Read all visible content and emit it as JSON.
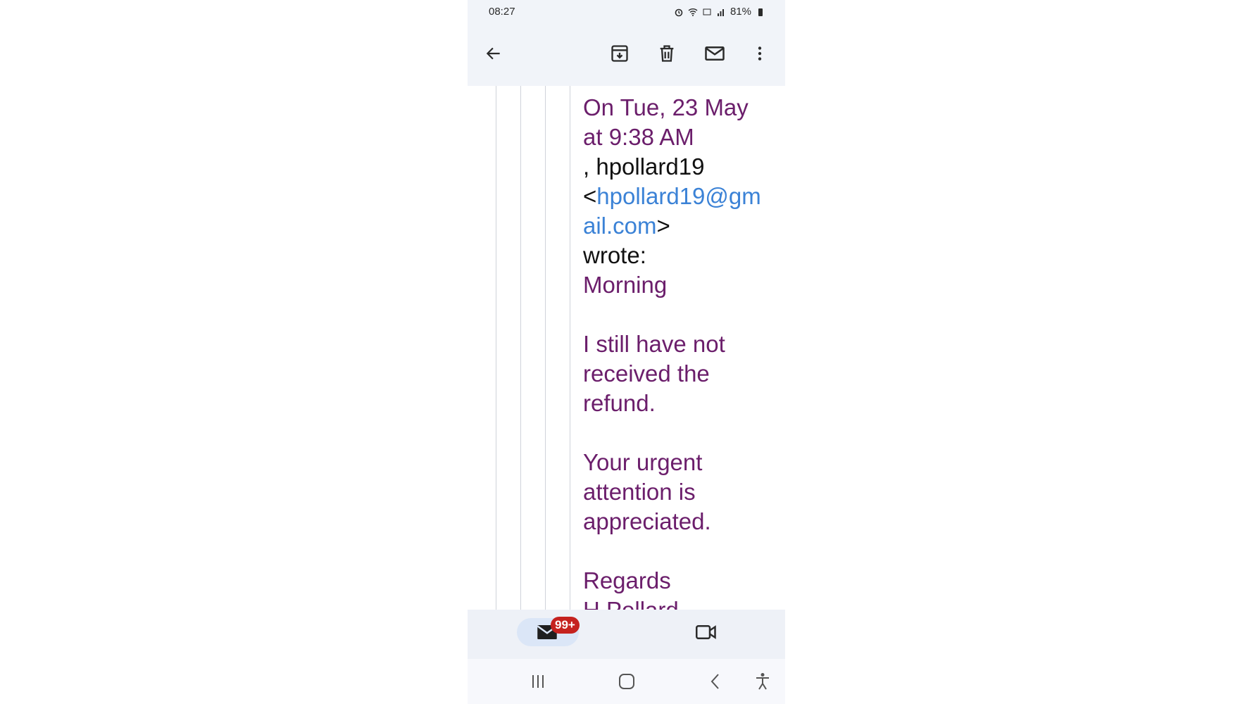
{
  "status_bar": {
    "time": "08:27",
    "battery": "81%",
    "icons": [
      "alarm-icon",
      "wifi-icon",
      "volte-icon",
      "signal-icon",
      "battery-icon"
    ]
  },
  "toolbar": {
    "icons": [
      "back-arrow-icon",
      "archive-icon",
      "delete-icon",
      "mark-unread-icon",
      "more-options-icon"
    ]
  },
  "email": {
    "header_line1": "On Tue, 23 May",
    "header_line2": "at 9:38 AM",
    "sender_prefix": ", hpollard19",
    "sender_open": "<",
    "sender_email": "hpollard19@gmail.com",
    "sender_close": ">",
    "wrote": "wrote:",
    "greeting": "Morning",
    "body_1": "I still have not received the refund.",
    "body_2": "Your urgent attention is appreciated.",
    "signoff": "Regards",
    "signature": "H Pollard"
  },
  "bottom_nav": {
    "mail_badge": "99+",
    "icons": [
      "mail-icon",
      "video-icon"
    ]
  },
  "system_nav": {
    "icons": [
      "recents-icon",
      "home-icon",
      "back-icon",
      "accessibility-icon"
    ]
  },
  "colors": {
    "quote_text": "#6b1e6b",
    "link": "#3b82d6",
    "badge": "#c5221f",
    "appbar_bg": "#f1f4f9"
  }
}
